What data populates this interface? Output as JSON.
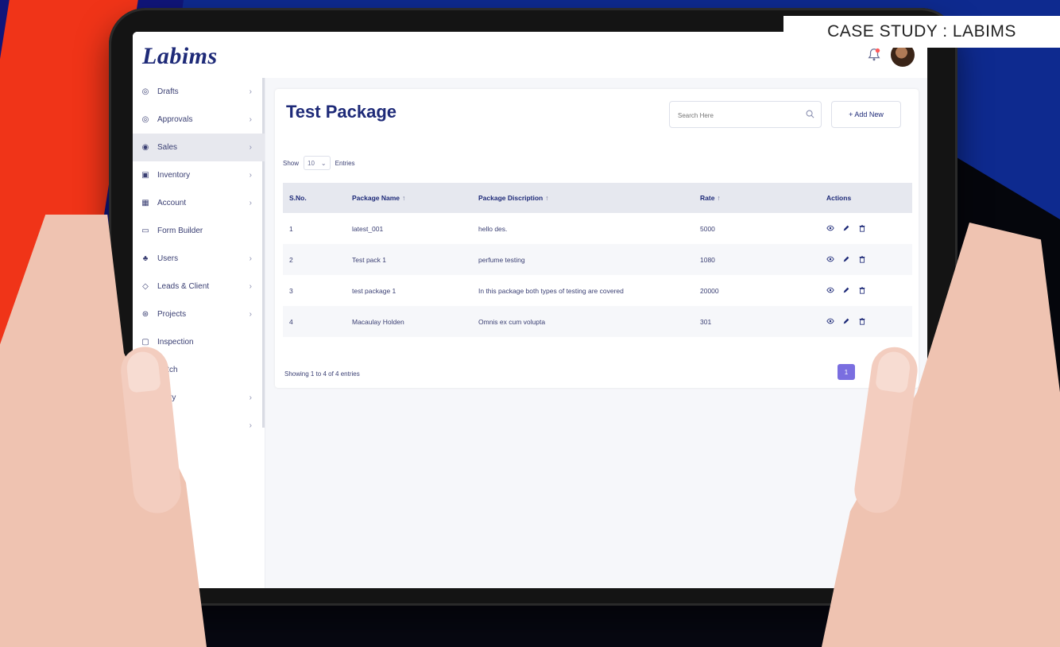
{
  "overlay_label": "CASE STUDY : LABIMS",
  "app": {
    "logo_text": "Labims"
  },
  "sidebar": {
    "items": [
      {
        "label": "Drafts",
        "icon": "draft-icon",
        "has_chevron": true
      },
      {
        "label": "Approvals",
        "icon": "approval-icon",
        "has_chevron": true
      },
      {
        "label": "Sales",
        "icon": "eye-icon",
        "has_chevron": true,
        "active": true
      },
      {
        "label": "Inventory",
        "icon": "calendar-icon",
        "has_chevron": true
      },
      {
        "label": "Account",
        "icon": "building-icon",
        "has_chevron": true
      },
      {
        "label": "Form Builder",
        "icon": "form-icon",
        "has_chevron": false
      },
      {
        "label": "Users",
        "icon": "users-icon",
        "has_chevron": true
      },
      {
        "label": "Leads & Client",
        "icon": "handshake-icon",
        "has_chevron": true
      },
      {
        "label": "Projects",
        "icon": "projects-icon",
        "has_chevron": true
      },
      {
        "label": "Inspection",
        "icon": "inspection-icon",
        "has_chevron": false
      },
      {
        "label": "Batch",
        "icon": "batch-icon",
        "has_chevron": false
      },
      {
        "label": "Entry",
        "icon": "entry-icon",
        "has_chevron": true
      },
      {
        "label": "",
        "icon": "settings-icon",
        "has_chevron": true
      }
    ]
  },
  "page": {
    "title": "Test Package",
    "search_placeholder": "Search Here",
    "add_button_label": "+ Add New",
    "show_label": "Show",
    "show_value": "10",
    "entries_label": "Entries",
    "footer_text": "Showing 1 to 4 of 4 entries",
    "page_button_label": "1"
  },
  "table": {
    "headers": [
      "S.No.",
      "Package Name",
      "Package Discription",
      "Rate",
      "Actions"
    ],
    "rows": [
      {
        "sno": "1",
        "name": "latest_001",
        "description": "hello des.",
        "rate": "5000"
      },
      {
        "sno": "2",
        "name": "Test pack 1",
        "description": "perfume testing",
        "rate": "1080"
      },
      {
        "sno": "3",
        "name": "test package 1",
        "description": "In this package both types of testing are covered",
        "rate": "20000"
      },
      {
        "sno": "4",
        "name": "Macaulay Holden",
        "description": "Omnis ex cum volupta",
        "rate": "301"
      }
    ]
  },
  "colors": {
    "brand": "#1e2a78",
    "accent": "#7a6ee0",
    "background_blue": "#0e2a8f",
    "background_red": "#f03418"
  }
}
